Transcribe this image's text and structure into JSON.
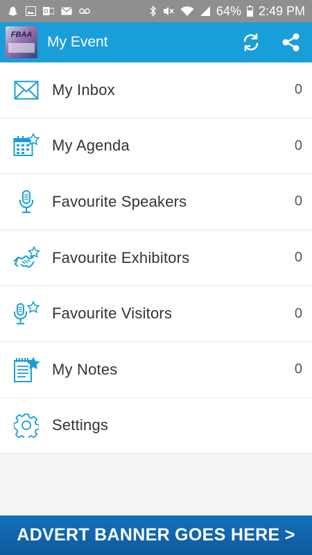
{
  "status_bar": {
    "battery": "64%",
    "time": "2:49 PM"
  },
  "app_bar": {
    "logo_text": "FBAA",
    "title": "My Event"
  },
  "menu": {
    "items": [
      {
        "label": "My Inbox",
        "count": "0",
        "icon": "envelope-icon"
      },
      {
        "label": "My Agenda",
        "count": "0",
        "icon": "calendar-star-icon"
      },
      {
        "label": "Favourite Speakers",
        "count": "0",
        "icon": "microphone-icon"
      },
      {
        "label": "Favourite Exhibitors",
        "count": "0",
        "icon": "handshake-star-icon"
      },
      {
        "label": "Favourite Visitors",
        "count": "0",
        "icon": "microphone-star-icon"
      },
      {
        "label": "My Notes",
        "count": "0",
        "icon": "notes-star-icon"
      },
      {
        "label": "Settings",
        "count": "",
        "icon": "gear-icon"
      }
    ]
  },
  "ad_banner": {
    "text": "ADVERT BANNER GOES HERE >"
  },
  "colors": {
    "app_bar": "#1a9ed9",
    "icon_blue": "#1a9ed9",
    "banner": "#1066ad",
    "status_bar": "#8f8f8f"
  }
}
